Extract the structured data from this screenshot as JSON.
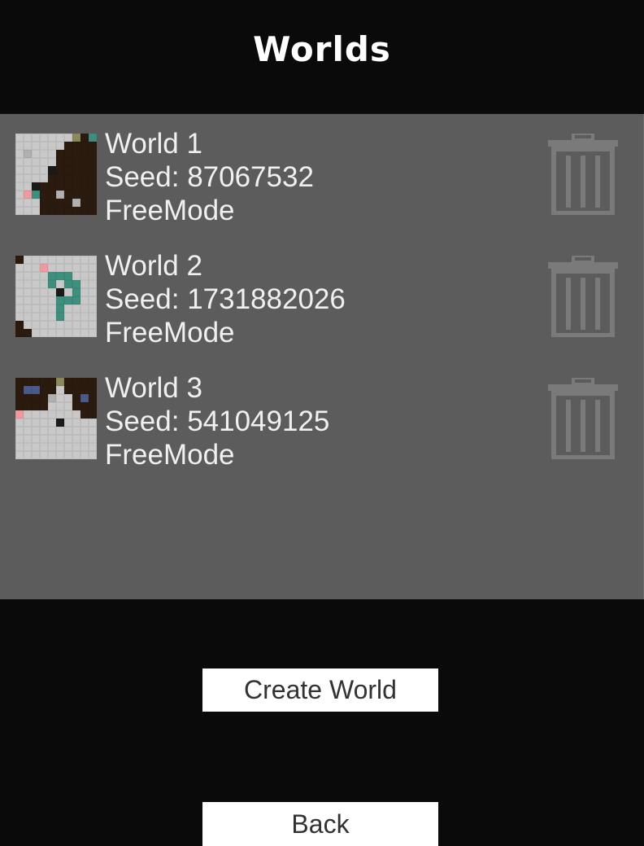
{
  "header": {
    "title": "Worlds"
  },
  "colors": {
    "background": "#0a0a0a",
    "panel": "#5c5c5c",
    "text": "#f0f0f0",
    "trash_icon": "#7a7a7a",
    "button_bg": "#ffffff",
    "button_text": "#323232"
  },
  "worlds": [
    {
      "name": "World 1",
      "seed": "Seed: 87067532",
      "mode": "FreeMode",
      "thumbnail_icon": "world-map-thumbnail",
      "delete_icon": "trash-icon",
      "tiles": [
        "GGGGGGGYDT",
        "GGGGGGDDDD",
        "GLGGGDDDDD",
        "GGGGGDDDDD",
        "GGGGKDDDDD",
        "GGGGDDDDDD",
        "GGKDDDDDDD",
        "GPTDDLDDDD",
        "GGGDDDDLDD",
        "GGGDDDDDDD"
      ]
    },
    {
      "name": "World 2",
      "seed": "Seed: 1731882026",
      "mode": "FreeMode",
      "thumbnail_icon": "world-map-thumbnail",
      "delete_icon": "trash-icon",
      "tiles": [
        "DGGGGGGGGG",
        "GGGPGGGGGG",
        "GGGGTTTGGG",
        "GGGGTGTTGG",
        "GGGGGKGTGG",
        "GGGGGTTTGG",
        "GGGGGTGGGG",
        "GGGGGTGGGG",
        "DGGGGGGGGG",
        "DDGGGGGGGG"
      ]
    },
    {
      "name": "World 3",
      "seed": "Seed: 541049125",
      "mode": "FreeMode",
      "thumbnail_icon": "world-map-thumbnail",
      "delete_icon": "trash-icon",
      "tiles": [
        "DDDDDYDDDD",
        "DBBDDGDDDD",
        "DDDDLGGDBD",
        "DDDDGGGDDD",
        "PGGGGGGGDD",
        "GGGGGKGGGG",
        "GGGGGGGGGG",
        "GGGGGGGGGG",
        "GGGGGGGGGG",
        "GGGGGGGGGG"
      ]
    }
  ],
  "tile_colors": {
    "G": "#c9c9c9",
    "L": "#b0b0b0",
    "D": "#2b1a0e",
    "K": "#1a1a1a",
    "P": "#f09aa0",
    "T": "#3f8f7f",
    "Y": "#8a8a5a",
    "B": "#4a5a8a"
  },
  "buttons": {
    "create_world": "Create World",
    "back": "Back"
  }
}
